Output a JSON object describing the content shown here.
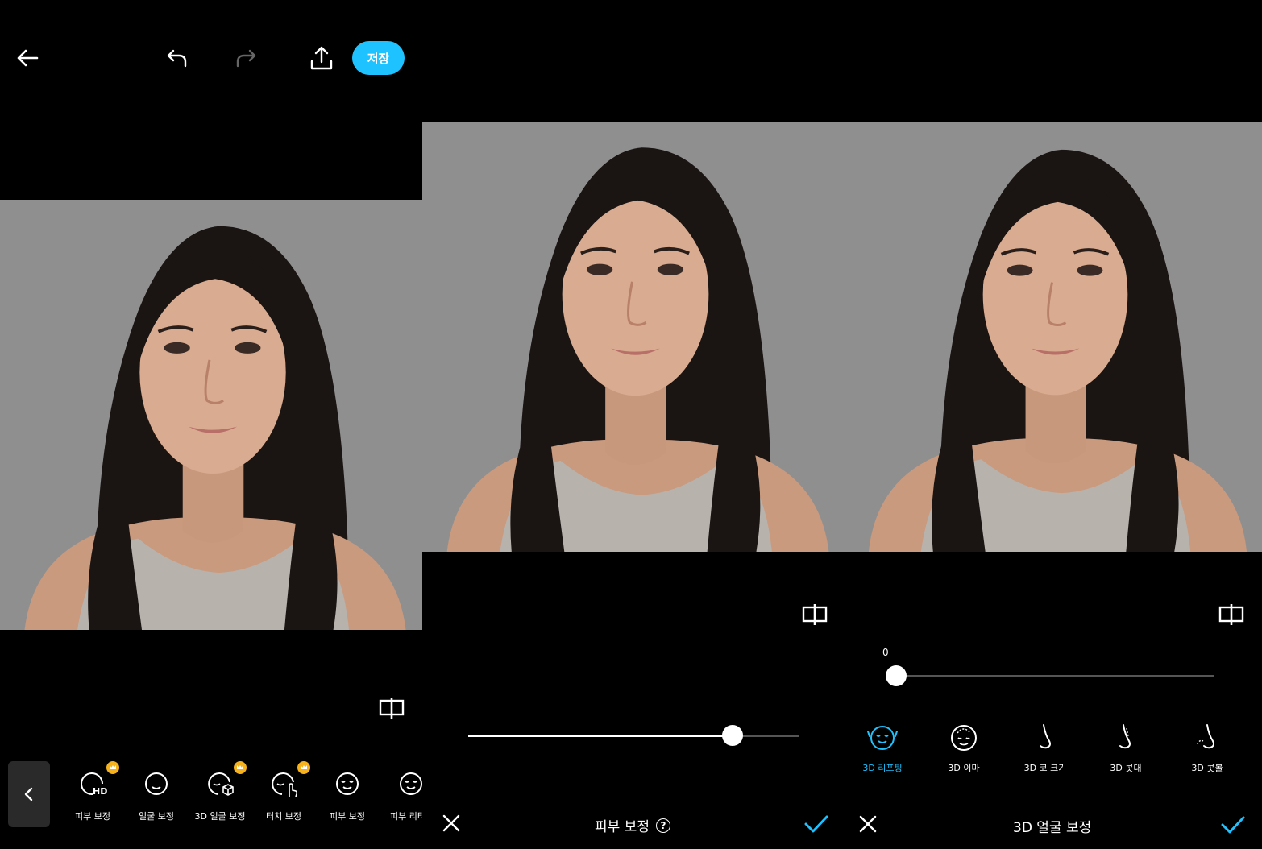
{
  "panel1": {
    "save_label": "저장",
    "tools": [
      {
        "label": "피부 보정",
        "icon": "face-hd-icon",
        "premium": true
      },
      {
        "label": "얼굴 보정",
        "icon": "face-outline-icon",
        "premium": false
      },
      {
        "label": "3D 얼굴 보정",
        "icon": "face-3d-icon",
        "premium": true
      },
      {
        "label": "터치 보정",
        "icon": "face-touch-icon",
        "premium": true
      },
      {
        "label": "피부 보정",
        "icon": "face-smile-icon",
        "premium": false
      },
      {
        "label": "피부 리터",
        "icon": "face-retouch-icon",
        "premium": false
      }
    ]
  },
  "panel2": {
    "title": "피부 보정",
    "help_symbol": "?",
    "slider_value": 0.8
  },
  "panel3": {
    "title": "3D 얼굴 보정",
    "slider_label": "0",
    "slider_value": 0,
    "tools": [
      {
        "label": "3D 리프팅",
        "icon": "face-lifting-icon",
        "active": true
      },
      {
        "label": "3D 이마",
        "icon": "forehead-icon",
        "active": false
      },
      {
        "label": "3D 코 크기",
        "icon": "nose-size-icon",
        "active": false
      },
      {
        "label": "3D 콧대",
        "icon": "nose-bridge-icon",
        "active": false
      },
      {
        "label": "3D 콧볼",
        "icon": "nostril-icon",
        "active": false
      }
    ]
  },
  "colors": {
    "accent": "#1ec2ff",
    "premium": "#f6b21c",
    "background": "#000000"
  }
}
